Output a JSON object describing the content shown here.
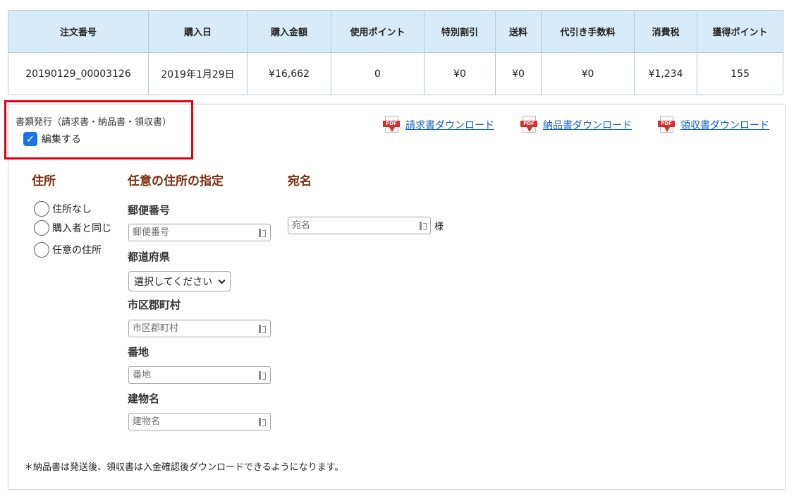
{
  "order_table": {
    "headers": [
      "注文番号",
      "購入日",
      "購入金額",
      "使用ポイント",
      "特別割引",
      "送料",
      "代引き手数料",
      "消費税",
      "獲得ポイント"
    ],
    "row": [
      "20190129_00003126",
      "2019年1月29日",
      "¥16,662",
      "0",
      "¥0",
      "¥0",
      "¥0",
      "¥1,234",
      "155"
    ]
  },
  "documents": {
    "title": "書類発行（請求書・納品書・領収書）",
    "edit_label": "編集する",
    "edit_checked": true,
    "downloads": [
      {
        "icon": "pdf-icon",
        "label": "請求書ダウンロード"
      },
      {
        "icon": "pdf-icon",
        "label": "納品書ダウンロード"
      },
      {
        "icon": "pdf-icon",
        "label": "領収書ダウンロード"
      }
    ]
  },
  "address": {
    "heading": "住所",
    "options": [
      "住所なし",
      "購入者と同じ",
      "任意の住所"
    ]
  },
  "custom_address": {
    "heading": "任意の住所の指定",
    "postal_label": "郵便番号",
    "postal_placeholder": "郵便番号",
    "prefecture_label": "都道府県",
    "prefecture_selected": "選択してください",
    "city_label": "市区郡町村",
    "city_placeholder": "市区郡町村",
    "street_label": "番地",
    "street_placeholder": "番地",
    "building_label": "建物名",
    "building_placeholder": "建物名"
  },
  "recipient": {
    "heading": "宛名",
    "placeholder": "宛名",
    "suffix": "様"
  },
  "note": "＊納品書は発送後、領収書は入金確認後ダウンロードできるようになります。",
  "colors": {
    "table_header_bg": "#d7ebfa",
    "highlight_border": "#e60012",
    "heading_color": "#7a2e0e",
    "link_color": "#1565c0",
    "checkbox_color": "#1a73e8"
  }
}
